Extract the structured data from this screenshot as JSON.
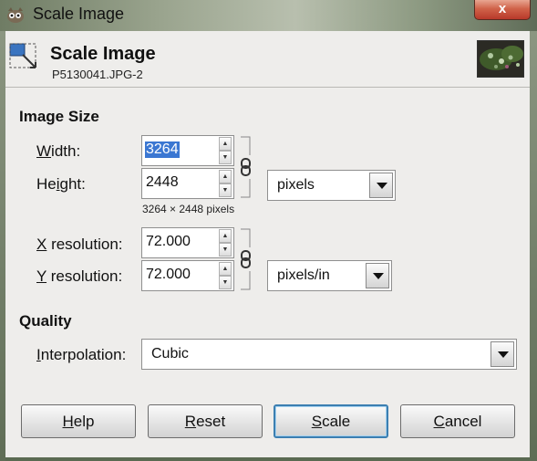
{
  "window": {
    "title": "Scale Image",
    "close_label": "x"
  },
  "header": {
    "title": "Scale Image",
    "subtitle": "P5130041.JPG-2"
  },
  "image_size": {
    "section_label": "Image Size",
    "width": {
      "label_u": "W",
      "label_rest": "idth:",
      "value": "3264"
    },
    "height": {
      "label_pre": "He",
      "label_u": "i",
      "label_rest": "ght:",
      "value": "2448"
    },
    "size_note": "3264 × 2448 pixels",
    "size_unit": "pixels",
    "xres": {
      "label_u": "X",
      "label_rest": " resolution:",
      "value": "72.000"
    },
    "yres": {
      "label_u": "Y",
      "label_rest": " resolution:",
      "value": "72.000"
    },
    "res_unit": "pixels/in"
  },
  "quality": {
    "section_label": "Quality",
    "interp_label_u": "I",
    "interp_label_rest": "nterpolation:",
    "interp_value": "Cubic"
  },
  "buttons": {
    "help_u": "H",
    "help_rest": "elp",
    "reset_u": "R",
    "reset_rest": "eset",
    "scale_u": "S",
    "scale_rest": "cale",
    "cancel_u": "C",
    "cancel_rest": "ancel"
  },
  "icons": [
    "gimp-icon",
    "close-icon",
    "scale-tool-icon",
    "chain-link-icon",
    "spin-up-arrow",
    "spin-down-arrow",
    "dropdown-arrow-icon"
  ],
  "colors": {
    "selection": "#3b77d2",
    "default_button_border": "#3c7fb1",
    "close_button": "#c64a36"
  }
}
